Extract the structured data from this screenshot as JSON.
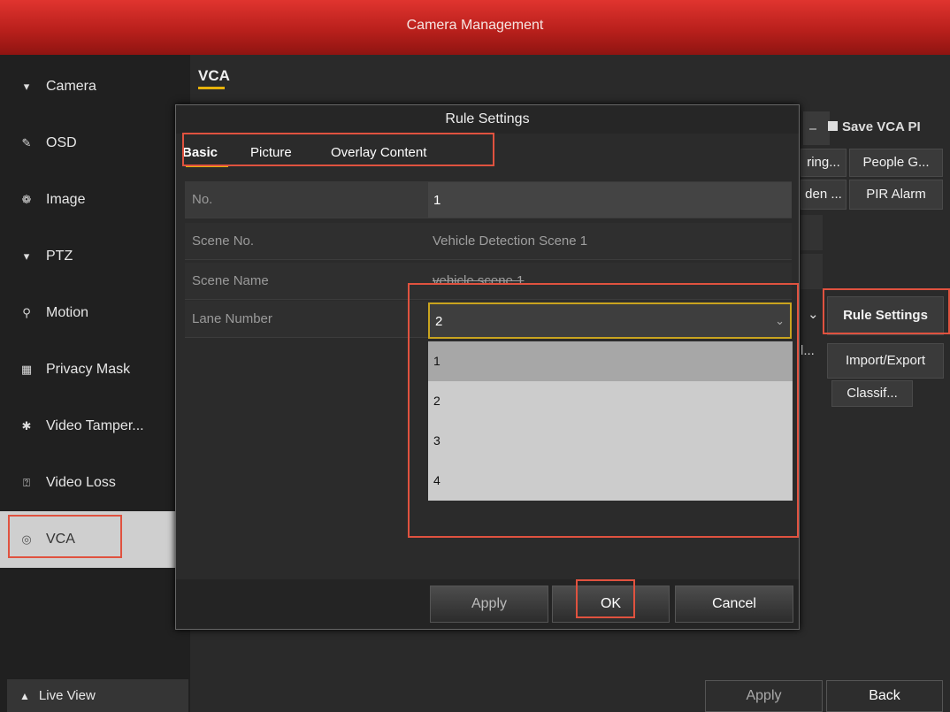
{
  "window": {
    "title": "Camera Management"
  },
  "sidebar": {
    "items": [
      {
        "label": "Camera",
        "icon": "camera-icon",
        "glyph": "▾"
      },
      {
        "label": "OSD",
        "icon": "pen-icon",
        "glyph": "✎"
      },
      {
        "label": "Image",
        "icon": "image-icon",
        "glyph": "❁"
      },
      {
        "label": "PTZ",
        "icon": "ptz-icon",
        "glyph": "▾"
      },
      {
        "label": "Motion",
        "icon": "motion-icon",
        "glyph": "⚲"
      },
      {
        "label": "Privacy Mask",
        "icon": "privacy-mask-icon",
        "glyph": "▦"
      },
      {
        "label": "Video Tamper...",
        "icon": "tamper-icon",
        "glyph": "✱"
      },
      {
        "label": "Video Loss",
        "icon": "video-loss-icon",
        "glyph": "⍰"
      },
      {
        "label": "VCA",
        "icon": "vca-icon",
        "glyph": "◎"
      }
    ],
    "live_view": "Live View"
  },
  "main": {
    "tab": "VCA",
    "save_vca": "Save VCA PI",
    "bg_buttons": [
      "ring...",
      "People G...",
      "den ...",
      "PIR Alarm",
      "Rule Settings",
      "Import/Export",
      "Classif...",
      "l..."
    ],
    "apply": "Apply",
    "back": "Back"
  },
  "dialog": {
    "title": "Rule Settings",
    "tabs": [
      "Basic",
      "Picture",
      "Overlay Content"
    ],
    "rows": [
      {
        "label": "No.",
        "value": "1"
      },
      {
        "label": "Scene No.",
        "value": "Vehicle Detection Scene 1"
      },
      {
        "label": "Scene Name",
        "value": "vehicle scene 1"
      },
      {
        "label": "Lane Number",
        "value": "2"
      }
    ],
    "lane_options": [
      "1",
      "2",
      "3",
      "4"
    ],
    "buttons": {
      "apply": "Apply",
      "ok": "OK",
      "cancel": "Cancel"
    }
  },
  "colors": {
    "title_red": "#c8231f",
    "accent_yellow": "#e7b20b",
    "highlight_box": "#e0523f"
  }
}
